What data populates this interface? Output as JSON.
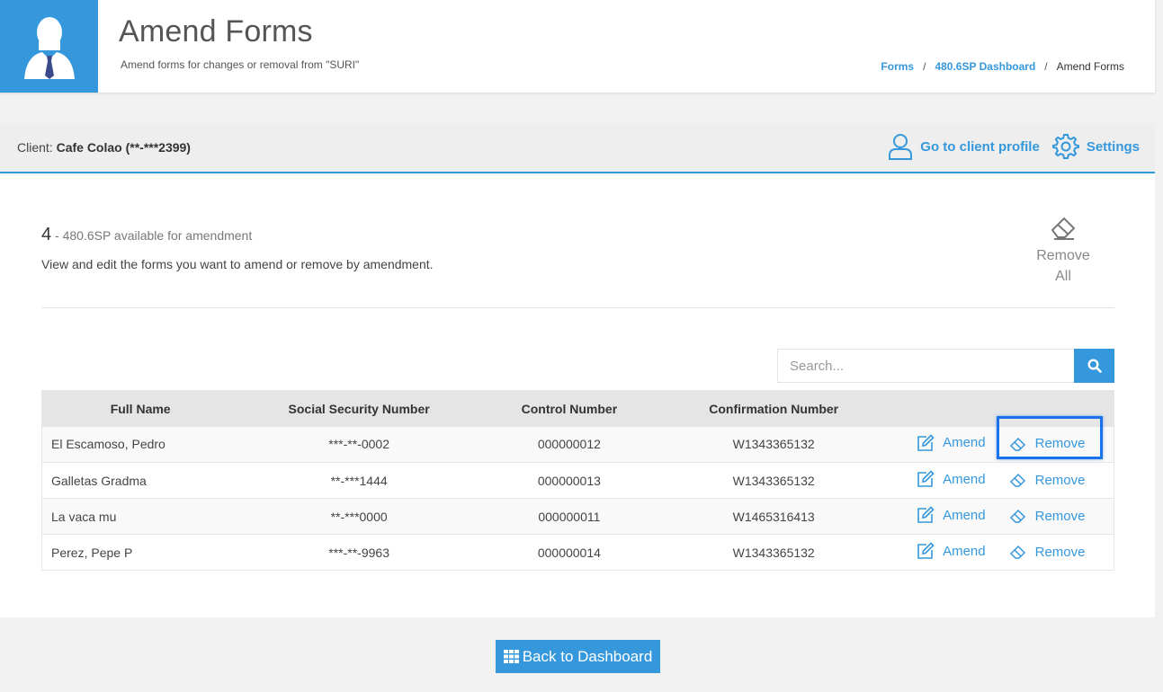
{
  "header": {
    "title": "Amend Forms",
    "subtitle": "Amend forms for changes or removal from \"SURI\"",
    "avatar_icon": "user-tie-icon",
    "breadcrumb": [
      {
        "label": "Forms"
      },
      {
        "label": "480.6SP Dashboard"
      },
      {
        "label": "Amend Forms"
      }
    ],
    "breadcrumb_sep": "/"
  },
  "client": {
    "prefix": "Client:",
    "name": "Cafe Colao (**-***2399)",
    "profile_link": "Go to client profile",
    "settings_link": "Settings"
  },
  "summary": {
    "count": "4",
    "count_text": "- 480.6SP available for amendment",
    "description": "View and edit the forms you want to amend or remove by amendment.",
    "remove_all_line1": "Remove",
    "remove_all_line2": "All"
  },
  "search": {
    "placeholder": "Search..."
  },
  "table": {
    "headers": [
      "Full Name",
      "Social Security Number",
      "Control Number",
      "Confirmation Number"
    ],
    "amend_label": "Amend",
    "remove_label": "Remove",
    "rows": [
      {
        "name": "El Escamoso, Pedro",
        "ssn": "***-**-0002",
        "control": "000000012",
        "confirmation": "W1343365132"
      },
      {
        "name": "Galletas Gradma",
        "ssn": "**-***1444",
        "control": "000000013",
        "confirmation": "W1343365132"
      },
      {
        "name": "La vaca mu",
        "ssn": "**-***0000",
        "control": "000000011",
        "confirmation": "W1465316413"
      },
      {
        "name": "Perez, Pepe P",
        "ssn": "***-**-9963",
        "control": "000000014",
        "confirmation": "W1343365132"
      }
    ]
  },
  "footer": {
    "back_label": "Back to Dashboard"
  },
  "colors": {
    "accent": "#3598dc",
    "highlight": "#1a73e8"
  }
}
